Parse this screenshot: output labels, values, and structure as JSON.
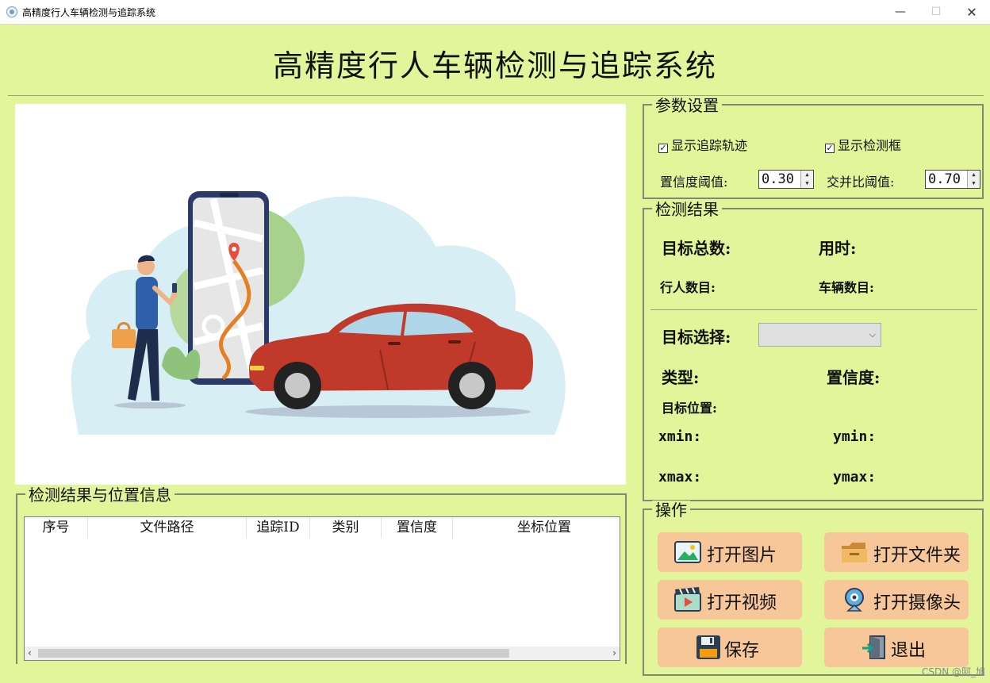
{
  "window": {
    "title": "高精度行人车辆检测与追踪系统",
    "minimize": "—",
    "maximize": "☐",
    "close": "✕"
  },
  "main_title": "高精度行人车辆检测与追踪系统",
  "params": {
    "legend": "参数设置",
    "show_track_label": "显示追踪轨迹",
    "show_track_checked": true,
    "show_box_label": "显示检测框",
    "show_box_checked": true,
    "conf_label": "置信度阈值:",
    "conf_value": "0.30",
    "iou_label": "交并比阈值:",
    "iou_value": "0.70"
  },
  "results": {
    "legend": "检测结果",
    "total_label": "目标总数:",
    "time_label": "用时:",
    "person_label": "行人数目:",
    "vehicle_label": "车辆数目:",
    "select_label": "目标选择:",
    "select_value": "",
    "type_label": "类型:",
    "conf_label": "置信度:",
    "position_label": "目标位置:",
    "xmin_label": "xmin:",
    "ymin_label": "ymin:",
    "xmax_label": "xmax:",
    "ymax_label": "ymax:"
  },
  "table": {
    "legend": "检测结果与位置信息",
    "columns": [
      "序号",
      "文件路径",
      "追踪ID",
      "类别",
      "置信度",
      "坐标位置"
    ]
  },
  "ops": {
    "legend": "操作",
    "open_image": "打开图片",
    "open_folder": "打开文件夹",
    "open_video": "打开视频",
    "open_camera": "打开摄像头",
    "save": "保存",
    "exit": "退出"
  },
  "watermark": "CSDN @阿_旭",
  "colors": {
    "background": "#e3f59a",
    "button": "#f7c79a",
    "car": "#c0392b"
  },
  "icons": [
    "image-icon",
    "folder-icon",
    "video-icon",
    "camera-icon",
    "save-icon",
    "exit-icon"
  ]
}
